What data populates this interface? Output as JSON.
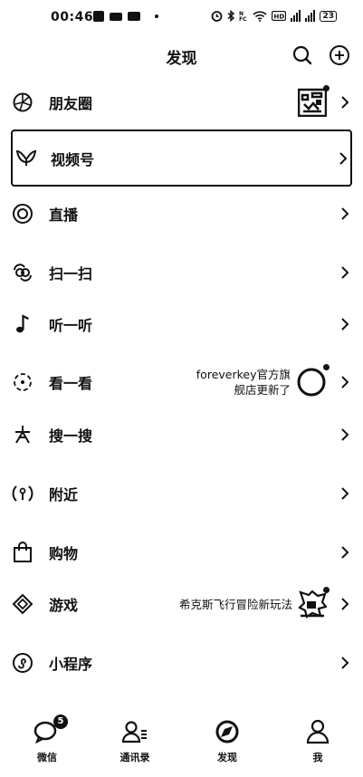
{
  "status_bar": {
    "time": "00:46",
    "battery": "23"
  },
  "header": {
    "title": "发现"
  },
  "menu": {
    "moments": {
      "label": "朋友圈"
    },
    "channels": {
      "label": "视频号"
    },
    "live": {
      "label": "直播"
    },
    "scan": {
      "label": "扫一扫"
    },
    "listen": {
      "label": "听一听"
    },
    "top_stories": {
      "label": "看一看",
      "note_line1": "foreverkey官方旗",
      "note_line2": "舰店更新了"
    },
    "search": {
      "label": "搜一搜"
    },
    "nearby": {
      "label": "附近"
    },
    "shopping": {
      "label": "购物"
    },
    "games": {
      "label": "游戏",
      "note": "希克斯飞行冒险新玩法"
    },
    "mini_programs": {
      "label": "小程序"
    }
  },
  "tabbar": {
    "chats": {
      "label": "微信",
      "badge": "5"
    },
    "contacts": {
      "label": "通讯录"
    },
    "discover": {
      "label": "发现"
    },
    "me": {
      "label": "我"
    }
  }
}
